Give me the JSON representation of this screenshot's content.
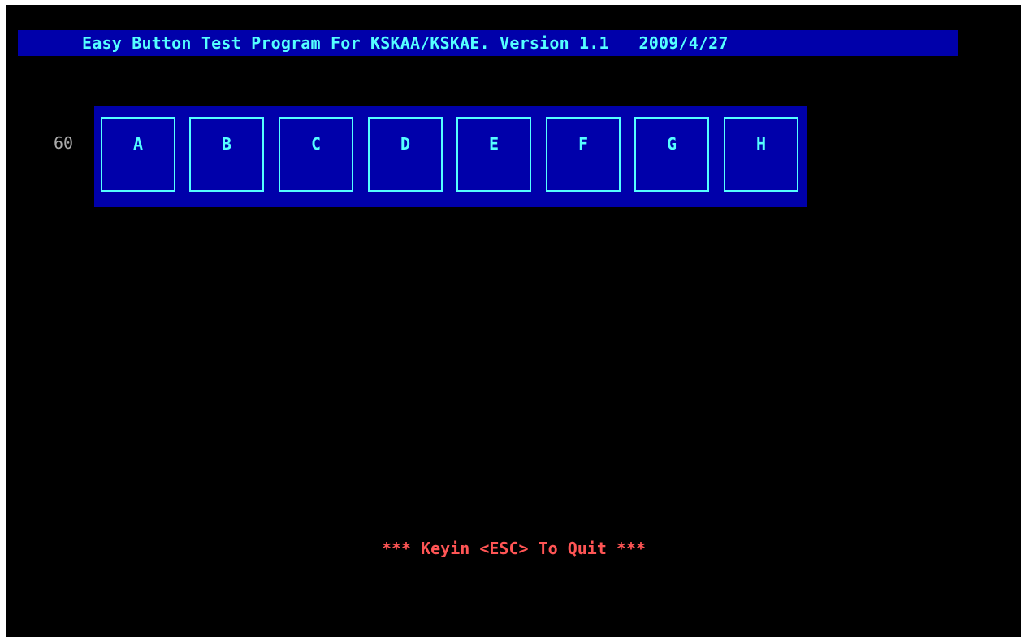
{
  "title_bar": {
    "text": "Easy Button Test Program For KSKAA/KSKAE. Version 1.1   2009/4/27"
  },
  "row_label": "60",
  "buttons": [
    {
      "label": "A"
    },
    {
      "label": "B"
    },
    {
      "label": "C"
    },
    {
      "label": "D"
    },
    {
      "label": "E"
    },
    {
      "label": "F"
    },
    {
      "label": "G"
    },
    {
      "label": "H"
    }
  ],
  "footer": {
    "quit_text": "*** Keyin <ESC> To Quit ***"
  },
  "colors": {
    "background": "#000000",
    "panel": "#0000aa",
    "accent": "#55ffff",
    "label_gray": "#aaaaaa",
    "quit_red": "#ff5555"
  }
}
